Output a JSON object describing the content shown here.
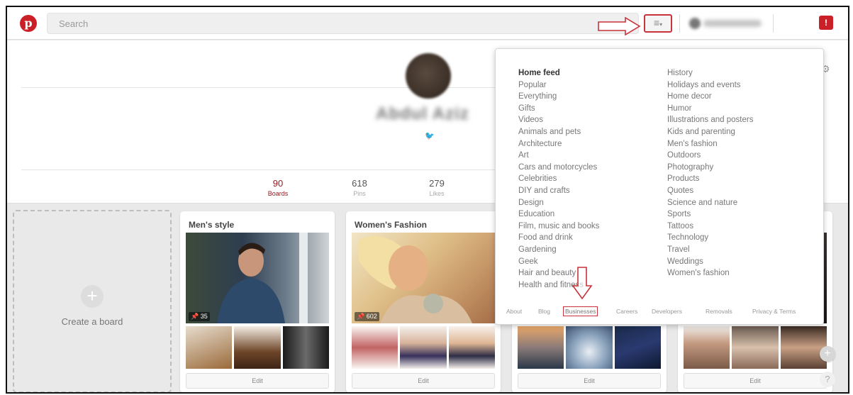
{
  "topbar": {
    "logo_letter": "p",
    "search_placeholder": "Search",
    "menu_icon": "≡",
    "notif_icon": "!"
  },
  "profile": {
    "name": "Abdul Aziz",
    "twitter_icon": "🐦",
    "stats": [
      {
        "num": "90",
        "label": "Boards"
      },
      {
        "num": "618",
        "label": "Pins"
      },
      {
        "num": "279",
        "label": "Likes"
      }
    ],
    "gear_icon": "⚙"
  },
  "create_board": {
    "plus": "+",
    "label": "Create a board"
  },
  "boards": [
    {
      "title": "Men's style",
      "count": "35",
      "edit": "Edit"
    },
    {
      "title": "Women's Fashion",
      "count": "602",
      "edit": "Edit"
    },
    {
      "title": "",
      "count": "",
      "edit": "Edit"
    },
    {
      "title": "",
      "count": "",
      "edit": "Edit"
    }
  ],
  "menu": {
    "left": [
      "Home feed",
      "Popular",
      "Everything",
      "Gifts",
      "Videos",
      "Animals and pets",
      "Architecture",
      "Art",
      "Cars and motorcycles",
      "Celebrities",
      "DIY and crafts",
      "Design",
      "Education",
      "Film, music and books",
      "Food and drink",
      "Gardening",
      "Geek",
      "Hair and beauty",
      "Health and fitness"
    ],
    "right": [
      "History",
      "Holidays and events",
      "Home decor",
      "Humor",
      "Illustrations and posters",
      "Kids and parenting",
      "Men's fashion",
      "Outdoors",
      "Photography",
      "Products",
      "Quotes",
      "Science and nature",
      "Sports",
      "Tattoos",
      "Technology",
      "Travel",
      "Weddings",
      "Women's fashion"
    ],
    "footer": [
      "About",
      "Blog",
      "Businesses",
      "Careers",
      "Developers",
      "Removals",
      "Privacy & Terms"
    ]
  },
  "fab": {
    "add": "+",
    "help": "?"
  },
  "colors": {
    "brand": "#cb2027",
    "highlight": "#c9323a"
  }
}
